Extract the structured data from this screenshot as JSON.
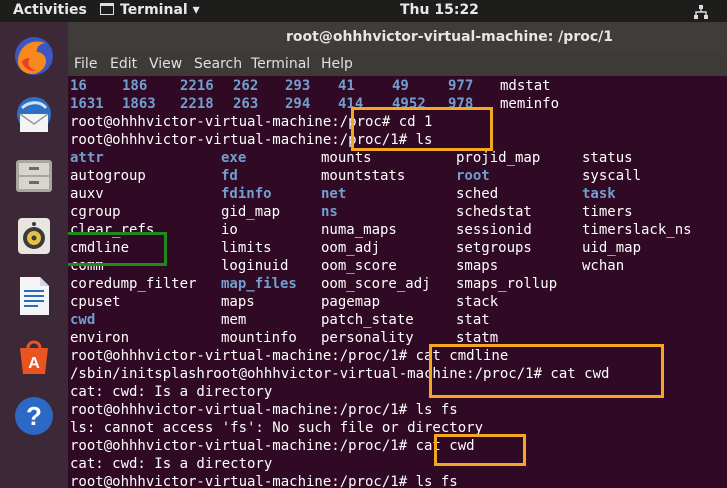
{
  "topbar": {
    "activities": "Activities",
    "app_menu": "Terminal ▾",
    "clock": "Thu 15:22",
    "network_icon": "network-wired-icon"
  },
  "window": {
    "title": "root@ohhhvictor-virtual-machine: /proc/1"
  },
  "menubar": [
    "File",
    "Edit",
    "View",
    "Search",
    "Terminal",
    "Help"
  ],
  "launcher": [
    "firefox-icon",
    "thunderbird-mail-icon",
    "files-icon",
    "rhythmbox-icon",
    "libreoffice-writer-icon",
    "software-center-icon",
    "help-icon"
  ],
  "terminal": {
    "pid_rows": [
      [
        "16",
        "186",
        "2216",
        "262",
        "293",
        "41",
        "49",
        "977",
        "mdstat"
      ],
      [
        "1631",
        "1863",
        "2218",
        "263",
        "294",
        "414",
        "4952",
        "978",
        "meminfo"
      ]
    ],
    "prompt_lines": [
      "root@ohhhvictor-virtual-machine:/proc# cd 1",
      "root@ohhhvictor-virtual-machine:/proc/1# ls"
    ],
    "ls_rows": [
      [
        {
          "t": "attr",
          "d": true
        },
        {
          "t": "exe",
          "d": true
        },
        {
          "t": "mounts",
          "d": false
        },
        {
          "t": "projid_map",
          "d": false
        },
        {
          "t": "status",
          "d": false
        }
      ],
      [
        {
          "t": "autogroup",
          "d": false
        },
        {
          "t": "fd",
          "d": true
        },
        {
          "t": "mountstats",
          "d": false
        },
        {
          "t": "root",
          "d": true
        },
        {
          "t": "syscall",
          "d": false
        }
      ],
      [
        {
          "t": "auxv",
          "d": false
        },
        {
          "t": "fdinfo",
          "d": true
        },
        {
          "t": "net",
          "d": true
        },
        {
          "t": "sched",
          "d": false
        },
        {
          "t": "task",
          "d": true
        }
      ],
      [
        {
          "t": "cgroup",
          "d": false
        },
        {
          "t": "gid_map",
          "d": false
        },
        {
          "t": "ns",
          "d": true
        },
        {
          "t": "schedstat",
          "d": false
        },
        {
          "t": "timers",
          "d": false
        }
      ],
      [
        {
          "t": "clear_refs",
          "d": false
        },
        {
          "t": "io",
          "d": false
        },
        {
          "t": "numa_maps",
          "d": false
        },
        {
          "t": "sessionid",
          "d": false
        },
        {
          "t": "timerslack_ns",
          "d": false
        }
      ],
      [
        {
          "t": "cmdline",
          "d": false
        },
        {
          "t": "limits",
          "d": false
        },
        {
          "t": "oom_adj",
          "d": false
        },
        {
          "t": "setgroups",
          "d": false
        },
        {
          "t": "uid_map",
          "d": false
        }
      ],
      [
        {
          "t": "comm",
          "d": false
        },
        {
          "t": "loginuid",
          "d": false
        },
        {
          "t": "oom_score",
          "d": false
        },
        {
          "t": "smaps",
          "d": false
        },
        {
          "t": "wchan",
          "d": false
        }
      ],
      [
        {
          "t": "coredump_filter",
          "d": false
        },
        {
          "t": "map_files",
          "d": true
        },
        {
          "t": "oom_score_adj",
          "d": false
        },
        {
          "t": "smaps_rollup",
          "d": false
        },
        {
          "t": "",
          "d": false
        }
      ],
      [
        {
          "t": "cpuset",
          "d": false
        },
        {
          "t": "maps",
          "d": false
        },
        {
          "t": "pagemap",
          "d": false
        },
        {
          "t": "stack",
          "d": false
        },
        {
          "t": "",
          "d": false
        }
      ],
      [
        {
          "t": "cwd",
          "d": true
        },
        {
          "t": "mem",
          "d": false
        },
        {
          "t": "patch_state",
          "d": false
        },
        {
          "t": "stat",
          "d": false
        },
        {
          "t": "",
          "d": false
        }
      ],
      [
        {
          "t": "environ",
          "d": false
        },
        {
          "t": "mountinfo",
          "d": false
        },
        {
          "t": "personality",
          "d": false
        },
        {
          "t": "statm",
          "d": false
        },
        {
          "t": "",
          "d": false
        }
      ]
    ],
    "output_lines": [
      "root@ohhhvictor-virtual-machine:/proc/1# cat cmdline",
      "/sbin/initsplashroot@ohhhvictor-virtual-machine:/proc/1# cat cwd",
      "cat: cwd: Is a directory",
      "root@ohhhvictor-virtual-machine:/proc/1# ls fs",
      "ls: cannot access 'fs': No such file or directory",
      "root@ohhhvictor-virtual-machine:/proc/1# cat cwd",
      "cat: cwd: Is a directory",
      "root@ohhhvictor-virtual-machine:/proc/1# ls fs"
    ]
  }
}
